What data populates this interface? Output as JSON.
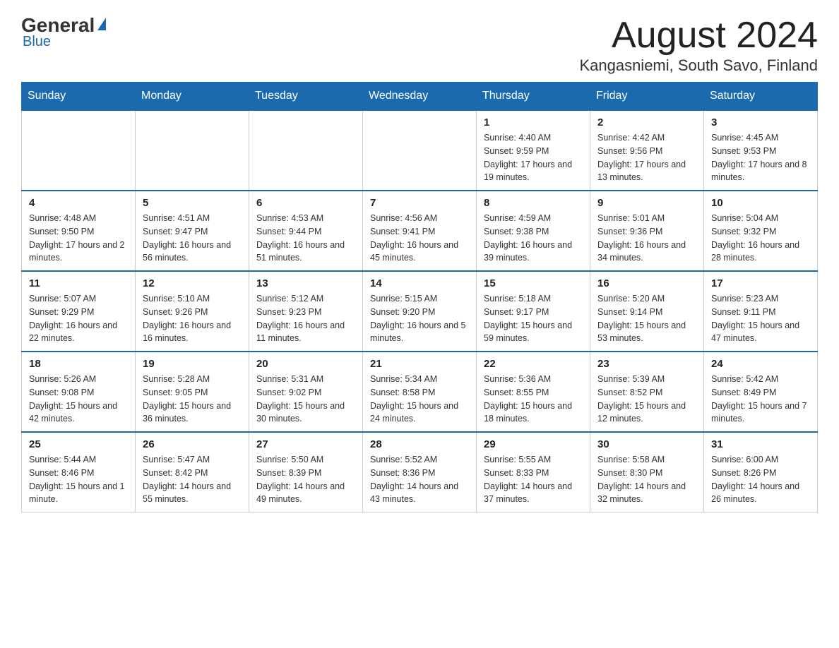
{
  "logo": {
    "general": "General",
    "blue": "Blue"
  },
  "header": {
    "title": "August 2024",
    "subtitle": "Kangasniemi, South Savo, Finland"
  },
  "days_of_week": [
    "Sunday",
    "Monday",
    "Tuesday",
    "Wednesday",
    "Thursday",
    "Friday",
    "Saturday"
  ],
  "weeks": [
    [
      {
        "day": "",
        "info": ""
      },
      {
        "day": "",
        "info": ""
      },
      {
        "day": "",
        "info": ""
      },
      {
        "day": "",
        "info": ""
      },
      {
        "day": "1",
        "info": "Sunrise: 4:40 AM\nSunset: 9:59 PM\nDaylight: 17 hours and 19 minutes."
      },
      {
        "day": "2",
        "info": "Sunrise: 4:42 AM\nSunset: 9:56 PM\nDaylight: 17 hours and 13 minutes."
      },
      {
        "day": "3",
        "info": "Sunrise: 4:45 AM\nSunset: 9:53 PM\nDaylight: 17 hours and 8 minutes."
      }
    ],
    [
      {
        "day": "4",
        "info": "Sunrise: 4:48 AM\nSunset: 9:50 PM\nDaylight: 17 hours and 2 minutes."
      },
      {
        "day": "5",
        "info": "Sunrise: 4:51 AM\nSunset: 9:47 PM\nDaylight: 16 hours and 56 minutes."
      },
      {
        "day": "6",
        "info": "Sunrise: 4:53 AM\nSunset: 9:44 PM\nDaylight: 16 hours and 51 minutes."
      },
      {
        "day": "7",
        "info": "Sunrise: 4:56 AM\nSunset: 9:41 PM\nDaylight: 16 hours and 45 minutes."
      },
      {
        "day": "8",
        "info": "Sunrise: 4:59 AM\nSunset: 9:38 PM\nDaylight: 16 hours and 39 minutes."
      },
      {
        "day": "9",
        "info": "Sunrise: 5:01 AM\nSunset: 9:36 PM\nDaylight: 16 hours and 34 minutes."
      },
      {
        "day": "10",
        "info": "Sunrise: 5:04 AM\nSunset: 9:32 PM\nDaylight: 16 hours and 28 minutes."
      }
    ],
    [
      {
        "day": "11",
        "info": "Sunrise: 5:07 AM\nSunset: 9:29 PM\nDaylight: 16 hours and 22 minutes."
      },
      {
        "day": "12",
        "info": "Sunrise: 5:10 AM\nSunset: 9:26 PM\nDaylight: 16 hours and 16 minutes."
      },
      {
        "day": "13",
        "info": "Sunrise: 5:12 AM\nSunset: 9:23 PM\nDaylight: 16 hours and 11 minutes."
      },
      {
        "day": "14",
        "info": "Sunrise: 5:15 AM\nSunset: 9:20 PM\nDaylight: 16 hours and 5 minutes."
      },
      {
        "day": "15",
        "info": "Sunrise: 5:18 AM\nSunset: 9:17 PM\nDaylight: 15 hours and 59 minutes."
      },
      {
        "day": "16",
        "info": "Sunrise: 5:20 AM\nSunset: 9:14 PM\nDaylight: 15 hours and 53 minutes."
      },
      {
        "day": "17",
        "info": "Sunrise: 5:23 AM\nSunset: 9:11 PM\nDaylight: 15 hours and 47 minutes."
      }
    ],
    [
      {
        "day": "18",
        "info": "Sunrise: 5:26 AM\nSunset: 9:08 PM\nDaylight: 15 hours and 42 minutes."
      },
      {
        "day": "19",
        "info": "Sunrise: 5:28 AM\nSunset: 9:05 PM\nDaylight: 15 hours and 36 minutes."
      },
      {
        "day": "20",
        "info": "Sunrise: 5:31 AM\nSunset: 9:02 PM\nDaylight: 15 hours and 30 minutes."
      },
      {
        "day": "21",
        "info": "Sunrise: 5:34 AM\nSunset: 8:58 PM\nDaylight: 15 hours and 24 minutes."
      },
      {
        "day": "22",
        "info": "Sunrise: 5:36 AM\nSunset: 8:55 PM\nDaylight: 15 hours and 18 minutes."
      },
      {
        "day": "23",
        "info": "Sunrise: 5:39 AM\nSunset: 8:52 PM\nDaylight: 15 hours and 12 minutes."
      },
      {
        "day": "24",
        "info": "Sunrise: 5:42 AM\nSunset: 8:49 PM\nDaylight: 15 hours and 7 minutes."
      }
    ],
    [
      {
        "day": "25",
        "info": "Sunrise: 5:44 AM\nSunset: 8:46 PM\nDaylight: 15 hours and 1 minute."
      },
      {
        "day": "26",
        "info": "Sunrise: 5:47 AM\nSunset: 8:42 PM\nDaylight: 14 hours and 55 minutes."
      },
      {
        "day": "27",
        "info": "Sunrise: 5:50 AM\nSunset: 8:39 PM\nDaylight: 14 hours and 49 minutes."
      },
      {
        "day": "28",
        "info": "Sunrise: 5:52 AM\nSunset: 8:36 PM\nDaylight: 14 hours and 43 minutes."
      },
      {
        "day": "29",
        "info": "Sunrise: 5:55 AM\nSunset: 8:33 PM\nDaylight: 14 hours and 37 minutes."
      },
      {
        "day": "30",
        "info": "Sunrise: 5:58 AM\nSunset: 8:30 PM\nDaylight: 14 hours and 32 minutes."
      },
      {
        "day": "31",
        "info": "Sunrise: 6:00 AM\nSunset: 8:26 PM\nDaylight: 14 hours and 26 minutes."
      }
    ]
  ]
}
